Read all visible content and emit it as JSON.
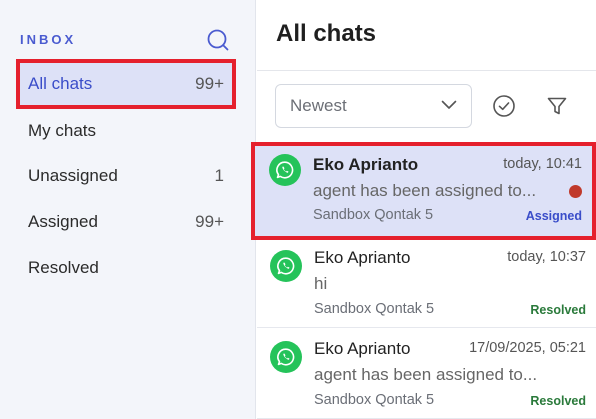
{
  "sidebar": {
    "title": "INBOX",
    "items": [
      {
        "label": "All chats",
        "count": "99+"
      },
      {
        "label": "My chats",
        "count": ""
      },
      {
        "label": "Unassigned",
        "count": "1"
      },
      {
        "label": "Assigned",
        "count": "99+"
      },
      {
        "label": "Resolved",
        "count": ""
      }
    ]
  },
  "main": {
    "title": "All chats",
    "sort": {
      "value": "Newest"
    }
  },
  "chats": [
    {
      "name": "Eko Aprianto",
      "time": "today, 10:41",
      "preview": "agent has been assigned to...",
      "source": "Sandbox Qontak 5",
      "status": "Assigned"
    },
    {
      "name": "Eko Aprianto",
      "time": "today, 10:37",
      "preview": "hi",
      "source": "Sandbox Qontak 5",
      "status": "Resolved"
    },
    {
      "name": "Eko Aprianto",
      "time": "17/09/2025, 05:21",
      "preview": "agent has been assigned to...",
      "source": "Sandbox Qontak 5",
      "status": "Resolved"
    }
  ],
  "colors": {
    "accent": "#3a4dc9",
    "highlight": "#e5202d",
    "whatsapp": "#25c35a",
    "resolved": "#2a7a3b",
    "unread": "#c0392b"
  },
  "icons": {
    "search": "search-icon",
    "chevron": "chevron-down-icon",
    "check": "check-circle-icon",
    "filter": "filter-icon",
    "whatsapp": "whatsapp-icon"
  }
}
